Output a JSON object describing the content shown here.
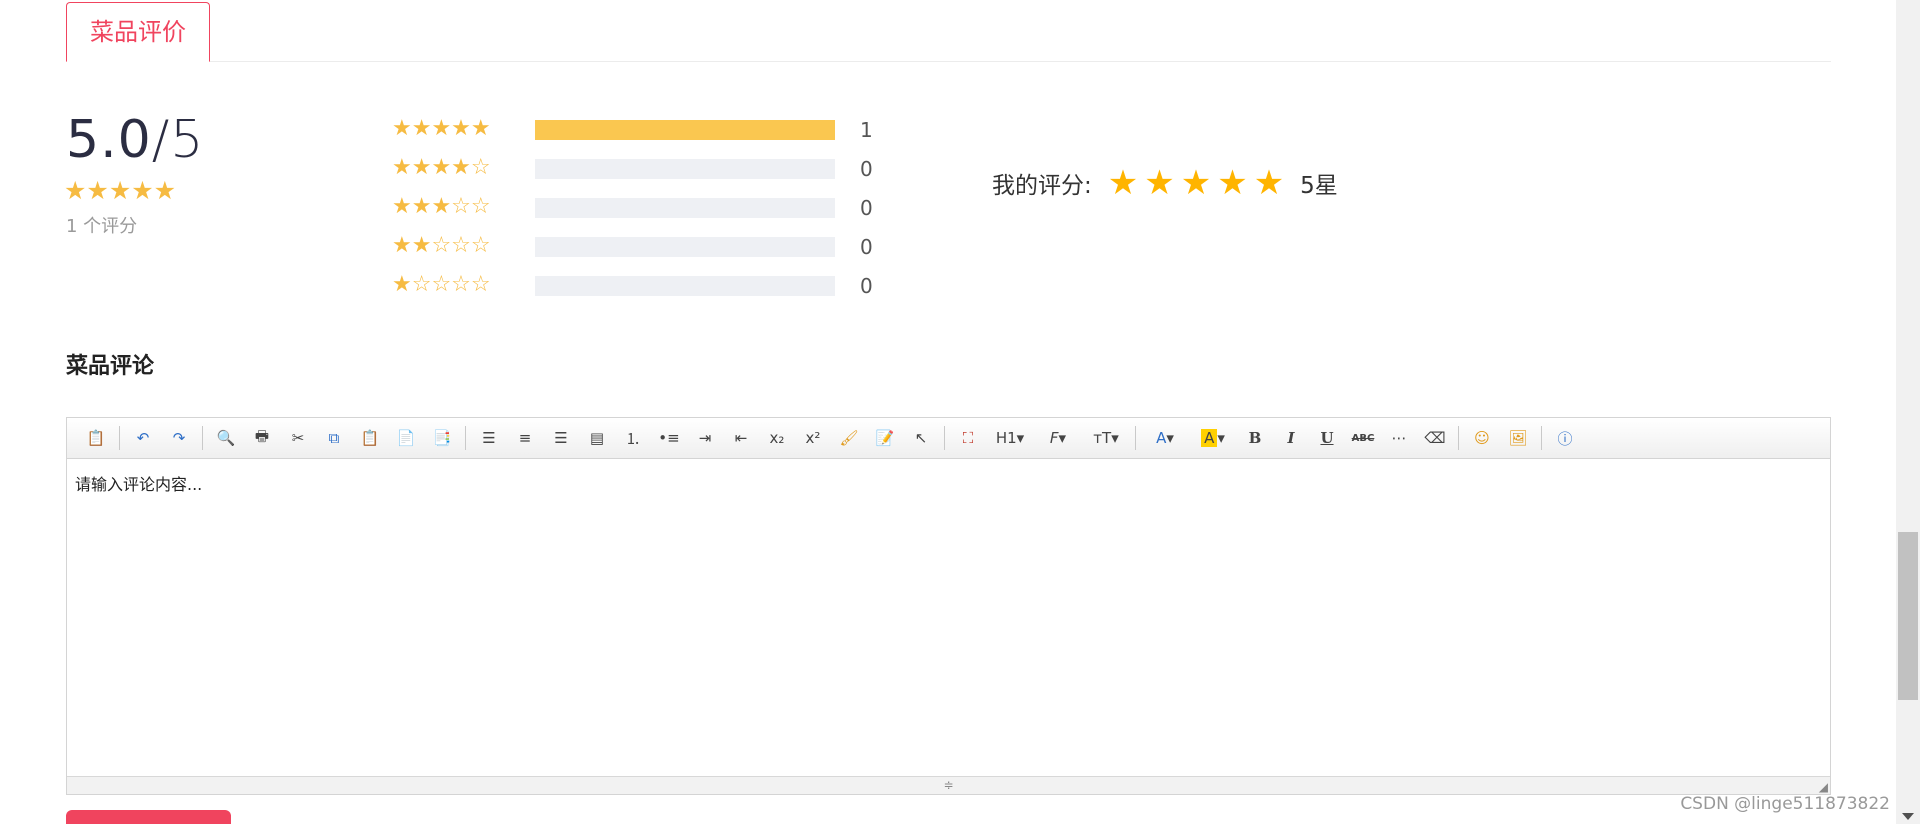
{
  "tabs": [
    {
      "label": "菜品评价",
      "active": true
    }
  ],
  "summary": {
    "score": "5.0",
    "max": "/5",
    "stars": "★★★★★",
    "count_text": "1 个评分"
  },
  "distribution": [
    {
      "stars": "★★★★★",
      "count": "1",
      "fraction": 1.0
    },
    {
      "stars": "★★★★☆",
      "count": "0",
      "fraction": 0
    },
    {
      "stars": "★★★☆☆",
      "count": "0",
      "fraction": 0
    },
    {
      "stars": "★★☆☆☆",
      "count": "0",
      "fraction": 0
    },
    {
      "stars": "★☆☆☆☆",
      "count": "0",
      "fraction": 0
    }
  ],
  "my_rating": {
    "label": "我的评分:",
    "stars": [
      "★",
      "★",
      "★",
      "★",
      "★"
    ],
    "value_text": "5星"
  },
  "comments": {
    "heading": "菜品评论",
    "placeholder": "请输入评论内容..."
  },
  "toolbar": {
    "heading_label": "H1",
    "font_family_label": "F",
    "font_size_label": "тT",
    "font_color_label": "A",
    "bg_color_label": "A",
    "bold_label": "B",
    "italic_label": "I",
    "underline_label": "U",
    "strike_label": "ABC",
    "subscript_label": "x₂",
    "superscript_label": "x²"
  },
  "colors": {
    "accent": "#f0445e",
    "star": "#f6bb42",
    "bar_fill": "#fac750",
    "bar_track": "#eef0f4"
  },
  "watermark": "CSDN @linge511873822"
}
